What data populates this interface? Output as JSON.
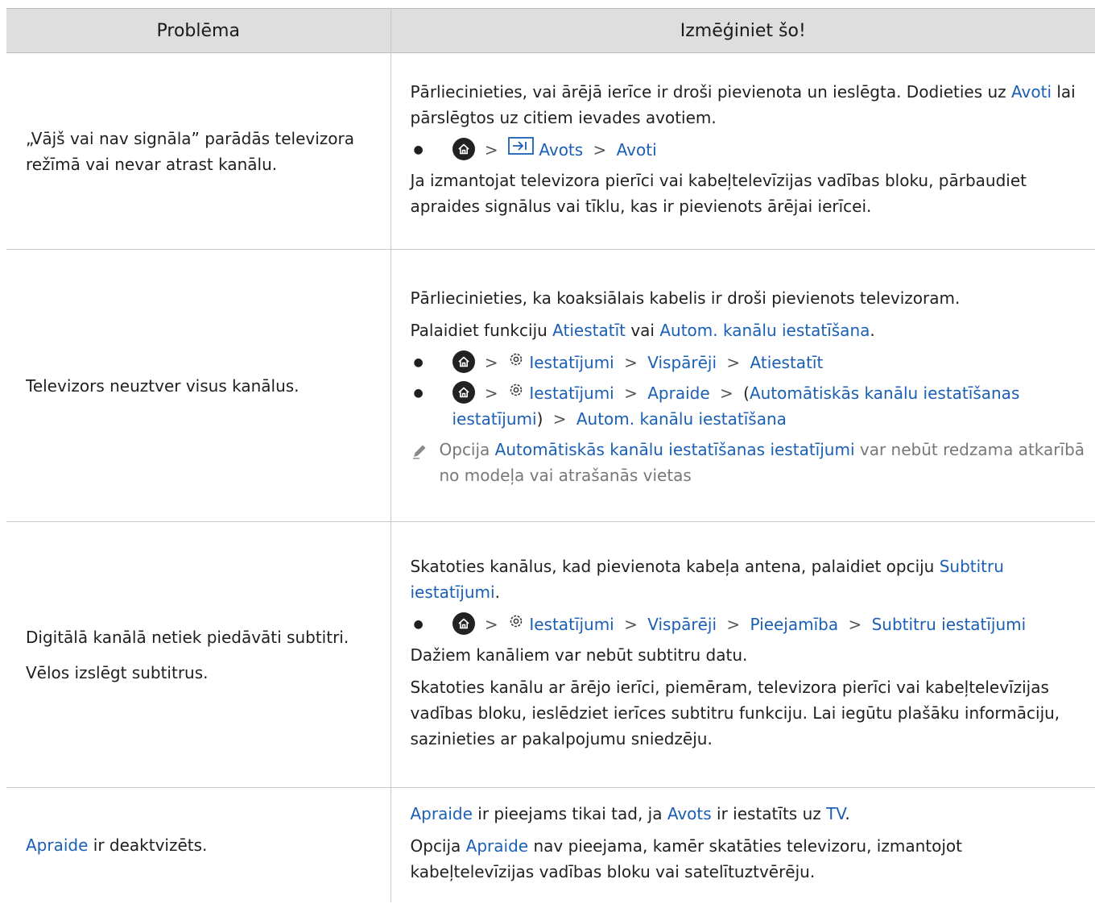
{
  "header": {
    "col1": "Problēma",
    "col2": "Izmēģiniet šo!"
  },
  "rows": [
    {
      "problem": "„Vājš vai nav signāla” parādās televizora režīmā vai nevar atrast kanālu.",
      "p1_a": "Pārliecinieties, vai ārējā ierīce ir droši pievienota un ieslēgta. Dodieties uz ",
      "p1_link": "Avoti",
      "p1_b": " lai pārslēgtos uz citiem ievades avotiem.",
      "path": [
        "Avots",
        "Avoti"
      ],
      "p2": "Ja izmantojat televizora pierīci vai kabeļtelevīzijas vadības bloku, pārbaudiet apraides signālus vai tīklu, kas ir pievienots ārējai ierīcei."
    },
    {
      "problem": "Televizors neuztver visus kanālus.",
      "p1": "Pārliecinieties, ka koaksiālais kabelis ir droši pievienots televizoram.",
      "p2_a": "Palaidiet funkciju ",
      "p2_link1": "Atiestatīt",
      "p2_mid": " vai ",
      "p2_link2": "Autom. kanālu iestatīšana",
      "p2_end": ".",
      "path1": [
        "Iestatījumi",
        "Vispārēji",
        "Atiestatīt"
      ],
      "path2": [
        "Iestatījumi",
        "Apraide",
        "Automātiskās kanālu iestatīšanas iestatījumi",
        "Autom. kanālu iestatīšana"
      ],
      "note_a": "Opcija ",
      "note_link": "Automātiskās kanālu iestatīšanas iestatījumi",
      "note_b": " var nebūt redzama atkarībā no modeļa vai atrašanās vietas"
    },
    {
      "problem1": "Digitālā kanālā netiek piedāvāti subtitri.",
      "problem2": "Vēlos izslēgt subtitrus.",
      "p1_a": "Skatoties kanālus, kad pievienota kabeļa antena, palaidiet opciju ",
      "p1_link": "Subtitru iestatījumi",
      "p1_end": ".",
      "path": [
        "Iestatījumi",
        "Vispārēji",
        "Pieejamība",
        "Subtitru iestatījumi"
      ],
      "p2": "Dažiem kanāliem var nebūt subtitru datu.",
      "p3": "Skatoties kanālu ar ārējo ierīci, piemēram, televizora pierīci vai kabeļtelevīzijas vadības bloku, ieslēdziet ierīces subtitru funkciju. Lai iegūtu plašāku informāciju, sazinieties ar pakalpojumu sniedzēju."
    },
    {
      "problem_link": "Apraide",
      "problem_rest": " ir deaktvizēts.",
      "p1_link1": "Apraide",
      "p1_mid1": " ir pieejams tikai tad, ja ",
      "p1_link2": "Avots",
      "p1_mid2": " ir iestatīts uz ",
      "p1_link3": "TV",
      "p1_end": ".",
      "p2_a": "Opcija ",
      "p2_link": "Apraide",
      "p2_b": " nav pieejama, kamēr skatāties televizoru, izmantojot kabeļtelevīzijas vadības bloku vai satelītuztvērēju."
    }
  ],
  "icons": [
    "home-icon",
    "source-icon",
    "gear-icon",
    "pencil-icon",
    "chevron-right-icon"
  ],
  "colors": {
    "link": "#1a5fb4",
    "header_bg": "#dedede",
    "note_text": "#777777"
  }
}
